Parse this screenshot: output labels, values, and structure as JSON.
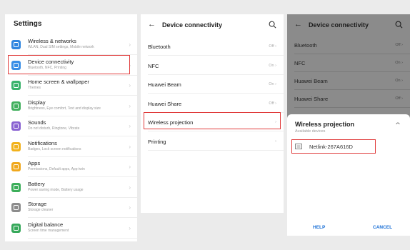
{
  "settings": {
    "title": "Settings",
    "items": [
      {
        "title": "Wireless & networks",
        "subtitle": "WLAN, Dual SIM settings, Mobile network",
        "color": "#2f86e0",
        "icon": "wifi-icon"
      },
      {
        "title": "Device connectivity",
        "subtitle": "Bluetooth, NFC, Printing",
        "color": "#3a8ee6",
        "icon": "device-connectivity-icon"
      },
      {
        "title": "Home screen & wallpaper",
        "subtitle": "Themes",
        "color": "#3bb36c",
        "icon": "home-screen-icon"
      },
      {
        "title": "Display",
        "subtitle": "Brightness, Eye comfort, Text and display size",
        "color": "#43b05f",
        "icon": "display-icon"
      },
      {
        "title": "Sounds",
        "subtitle": "Do not disturb, Ringtone, Vibrate",
        "color": "#8a63d2",
        "icon": "sound-icon"
      },
      {
        "title": "Notifications",
        "subtitle": "Badges, Lock screen notifications",
        "color": "#f2b21c",
        "icon": "notification-icon"
      },
      {
        "title": "Apps",
        "subtitle": "Permissions, Default apps, App twin",
        "color": "#f0a81d",
        "icon": "apps-icon"
      },
      {
        "title": "Battery",
        "subtitle": "Power saving mode, Battery usage",
        "color": "#3cae5a",
        "icon": "battery-icon"
      },
      {
        "title": "Storage",
        "subtitle": "Storage cleaner",
        "color": "#8c8c8c",
        "icon": "storage-icon"
      },
      {
        "title": "Digital balance",
        "subtitle": "Screen time management",
        "color": "#36a85a",
        "icon": "digital-balance-icon"
      }
    ]
  },
  "connectivity": {
    "back": "←",
    "title": "Device connectivity",
    "items": [
      {
        "label": "Bluetooth",
        "value": "Off"
      },
      {
        "label": "NFC",
        "value": "On"
      },
      {
        "label": "Huawei Beam",
        "value": "On"
      },
      {
        "label": "Huawei Share",
        "value": "Off"
      },
      {
        "label": "Wireless projection",
        "value": ""
      },
      {
        "label": "Printing",
        "value": ""
      }
    ]
  },
  "overlay": {
    "back": "←",
    "title": "Device connectivity",
    "items": [
      {
        "label": "Bluetooth",
        "value": "Off"
      },
      {
        "label": "NFC",
        "value": "On"
      },
      {
        "label": "Huawei Beam",
        "value": "On"
      },
      {
        "label": "Huawei Share",
        "value": "Off"
      }
    ],
    "dialog": {
      "title": "Wireless projection",
      "subtitle": "Available devices",
      "device": "Netlink-267A616D",
      "help": "HELP",
      "cancel": "CANCEL"
    }
  },
  "colors": {
    "highlight": "#e03b3b",
    "link": "#1a6fd6"
  }
}
